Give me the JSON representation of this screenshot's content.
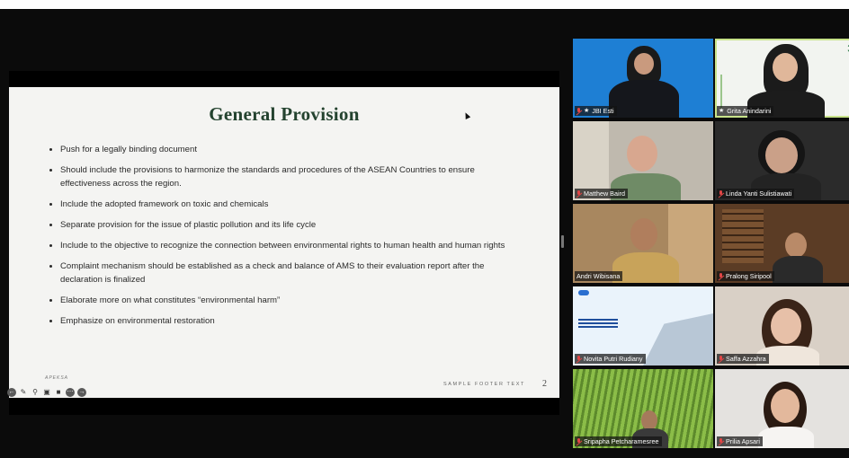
{
  "slide": {
    "title": "General Provision",
    "bullets": [
      "Push for a legally binding document",
      "Should include the provisions to harmonize the standards and procedures of the ASEAN Countries to ensure effectiveness across the region.",
      "Include the adopted framework on toxic and chemicals",
      "Separate provision for the issue of plastic pollution and its life cycle",
      "Include to the objective to recognize the connection between environmental rights to human health and human rights",
      "Complaint mechanism should be established as a check and balance of AMS to their evaluation report after the declaration is finalized",
      "Elaborate more on what constitutes “environmental harm”",
      "Emphasize on environmental restoration"
    ],
    "footer_text": "SAMPLE FOOTER TEXT",
    "page_number": "2",
    "brand": "APEKSA"
  },
  "presenter_toolbar": {
    "icons": [
      "prev-slide-icon",
      "pen-icon",
      "zoom-icon",
      "subtitles-icon",
      "camera-icon",
      "more-icon",
      "next-slide-icon"
    ]
  },
  "participants": [
    {
      "name": "JBI Esti",
      "pinned": true,
      "muted": true
    },
    {
      "name": "Grita Anindarini",
      "pinned": true,
      "muted": false,
      "active_speaker": true
    },
    {
      "name": "Matthew Baird",
      "muted": true
    },
    {
      "name": "Linda Yanti Sulistiawati",
      "muted": true
    },
    {
      "name": "Andri Wibisana",
      "muted": false
    },
    {
      "name": "Pralong Siripool",
      "muted": true
    },
    {
      "name": "Novita Putri Rudiany",
      "muted": true
    },
    {
      "name": "Saffa Azzahra",
      "muted": true
    },
    {
      "name": "Sripapha Petcharamesree",
      "muted": true
    },
    {
      "name": "Prilia Apsari",
      "muted": true
    }
  ],
  "colors": {
    "title_green": "#24432f",
    "active_speaker_border": "#c8e38a",
    "muted_red": "#e04545"
  }
}
